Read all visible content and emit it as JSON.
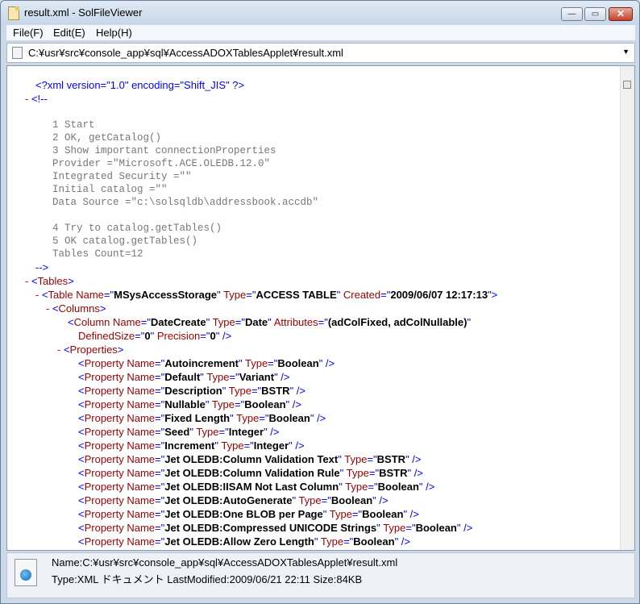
{
  "window": {
    "title": "result.xml - SolFileViewer",
    "minimize": "—",
    "maximize": "▭",
    "close": "✕"
  },
  "menu": [
    "File(F)",
    "Edit(E)",
    "Help(H)"
  ],
  "address": {
    "path": "C:¥usr¥src¥console_app¥sql¥AccessADOXTablesApplet¥result.xml",
    "arrow": "▼"
  },
  "xml": {
    "decl": "<?xml version=\"1.0\" encoding=\"Shift_JIS\" ?>",
    "comment_open": "<!--",
    "comment_lines": [
      "1 Start",
      "2 OK, getCatalog()",
      "3 Show important connectionProperties",
      "Provider =\"Microsoft.ACE.OLEDB.12.0\"",
      "Integrated Security =\"\"",
      "Initial catalog =\"\"",
      "Data Source =\"c:\\solsqldb\\addressbook.accdb\"",
      "",
      "4 Try to catalog.getTables()",
      "5 OK catalog.getTables()",
      "Tables Count=12"
    ],
    "comment_close": "-->",
    "tables_tag": "<Tables>",
    "table": {
      "name": "MSysAccessStorage",
      "type": "ACCESS TABLE",
      "created": "2009/06/07 12:17:13"
    },
    "columns_tag": "<Columns>",
    "column": {
      "name": "DateCreate",
      "type": "Date",
      "attributes": "(adColFixed, adColNullable)",
      "defined_size": "0",
      "precision": "0"
    },
    "properties_tag": "<Properties>",
    "properties": [
      {
        "name": "Autoincrement",
        "type": "Boolean"
      },
      {
        "name": "Default",
        "type": "Variant"
      },
      {
        "name": "Description",
        "type": "BSTR"
      },
      {
        "name": "Nullable",
        "type": "Boolean"
      },
      {
        "name": "Fixed Length",
        "type": "Boolean"
      },
      {
        "name": "Seed",
        "type": "Integer"
      },
      {
        "name": "Increment",
        "type": "Integer"
      },
      {
        "name": "Jet OLEDB:Column Validation Text",
        "type": "BSTR"
      },
      {
        "name": "Jet OLEDB:Column Validation Rule",
        "type": "BSTR"
      },
      {
        "name": "Jet OLEDB:IISAM Not Last Column",
        "type": "Boolean"
      },
      {
        "name": "Jet OLEDB:AutoGenerate",
        "type": "Boolean"
      },
      {
        "name": "Jet OLEDB:One BLOB per Page",
        "type": "Boolean"
      },
      {
        "name": "Jet OLEDB:Compressed UNICODE Strings",
        "type": "Boolean"
      },
      {
        "name": "Jet OLEDB:Allow Zero Length",
        "type": "Boolean"
      }
    ]
  },
  "status": {
    "name": "Name:C:¥usr¥src¥console_app¥sql¥AccessADOXTablesApplet¥result.xml",
    "meta": "Type:XML ドキュメント   LastModified:2009/06/21 22:11   Size:84KB"
  },
  "colors": {
    "tag": "#990000",
    "attr_markup": "#0000ff",
    "collapse": "#ee0000",
    "comment": "#777777"
  }
}
